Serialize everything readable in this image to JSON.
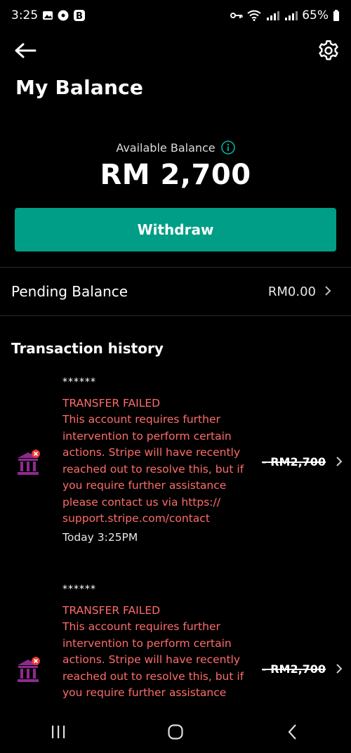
{
  "status_bar": {
    "time": "3:25",
    "battery": "65%",
    "icons_left": [
      "gallery-icon",
      "settings-app-icon",
      "b-app-icon"
    ],
    "icons_right": [
      "vpn-key-icon",
      "wifi-icon",
      "signal-icon",
      "signal-icon",
      "battery-icon"
    ]
  },
  "header": {
    "title": "My Balance"
  },
  "balance": {
    "label": "Available Balance",
    "amount": "RM 2,700",
    "withdraw_label": "Withdraw"
  },
  "pending": {
    "label": "Pending Balance",
    "value": "RM0.00"
  },
  "history": {
    "title": "Transaction history",
    "items": [
      {
        "masked": "******",
        "status": "TRANSFER FAILED",
        "message": "This account requires further intervention to perform certain actions. Stripe will have recently reached out to resolve this, but if you require further assistance please contact us via https:// support.stripe.com/contact",
        "date": "Today 3:25PM",
        "amount": "- RM2,700"
      },
      {
        "masked": "******",
        "status": "TRANSFER FAILED",
        "message": "This account requires further intervention to perform certain actions. Stripe will have recently reached out to resolve this, but if you require further assistance",
        "amount": "- RM2,700"
      }
    ]
  },
  "colors": {
    "accent": "#009e86",
    "error": "#ff6b6b",
    "bank_icon": "#8e2a8e"
  }
}
